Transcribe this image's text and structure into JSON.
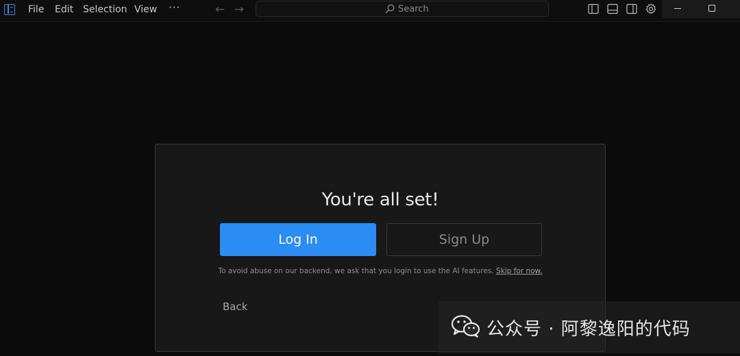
{
  "menu": {
    "file": "File",
    "edit": "Edit",
    "selection": "Selection",
    "view": "View",
    "more": "···"
  },
  "nav": {
    "back_icon": "arrow-left-icon",
    "forward_icon": "arrow-right-icon"
  },
  "search": {
    "placeholder": "Search"
  },
  "toolbar_icons": [
    "toggle-primary-sidebar-icon",
    "toggle-panel-icon",
    "toggle-secondary-sidebar-icon",
    "gear-icon"
  ],
  "window_controls": [
    "minimize-icon",
    "maximize-icon"
  ],
  "dialog": {
    "title": "You're all set!",
    "login_label": "Log In",
    "signup_label": "Sign Up",
    "notice_text": "To avoid abuse on our backend, we ask that you login to use the AI features.",
    "skip_label": "Skip for now.",
    "back_label": "Back"
  },
  "watermark": {
    "text": "公众号 · 阿黎逸阳的代码",
    "icon": "wechat-icon"
  },
  "colors": {
    "accent": "#2b8cf3",
    "background": "#0b0b0b",
    "dialog_bg": "#181818"
  }
}
